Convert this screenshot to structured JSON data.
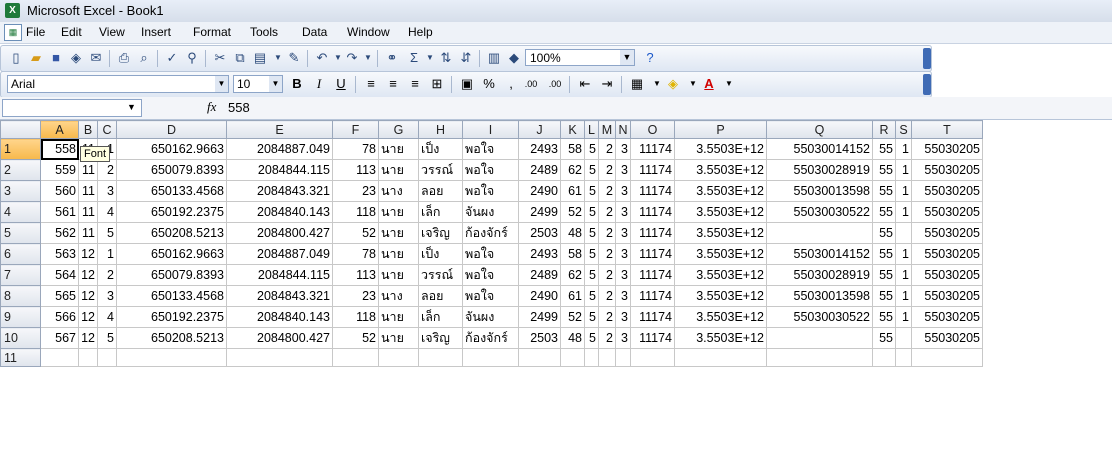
{
  "window": {
    "title": "Microsoft Excel - Book1",
    "app_icon_text": "X"
  },
  "menu": [
    "File",
    "Edit",
    "View",
    "Insert",
    "Format",
    "Tools",
    "Data",
    "Window",
    "Help"
  ],
  "toolbar": {
    "zoom": "100%"
  },
  "format_bar": {
    "font": "Arial",
    "size": "10",
    "bold": "B",
    "italic": "I",
    "underline": "U",
    "percent": "%",
    "comma": ",",
    "dec_inc": ".00",
    "dec_dec": ".00"
  },
  "formula_bar": {
    "fx": "fx",
    "value": "558"
  },
  "tooltip": "Font",
  "columns": [
    "A",
    "B",
    "C",
    "D",
    "E",
    "F",
    "G",
    "H",
    "I",
    "J",
    "K",
    "L",
    "M",
    "N",
    "O",
    "P",
    "Q",
    "R",
    "S",
    "T"
  ],
  "rows": [
    [
      "558",
      "11",
      "1",
      "650162.9663",
      "2084887.049",
      "78",
      "นาย",
      "เป็ง",
      "พอใจ",
      "2493",
      "58",
      "5",
      "2",
      "3",
      "11174",
      "3.5503E+12",
      "55030014152",
      "55",
      "1",
      "55030205"
    ],
    [
      "559",
      "11",
      "2",
      "650079.8393",
      "2084844.115",
      "113",
      "นาย",
      "วรรณ์",
      "พอใจ",
      "2489",
      "62",
      "5",
      "2",
      "3",
      "11174",
      "3.5503E+12",
      "55030028919",
      "55",
      "1",
      "55030205"
    ],
    [
      "560",
      "11",
      "3",
      "650133.4568",
      "2084843.321",
      "23",
      "นาง",
      "ลอย",
      "พอใจ",
      "2490",
      "61",
      "5",
      "2",
      "3",
      "11174",
      "3.5503E+12",
      "55030013598",
      "55",
      "1",
      "55030205"
    ],
    [
      "561",
      "11",
      "4",
      "650192.2375",
      "2084840.143",
      "118",
      "นาย",
      "เล็ก",
      "จันผง",
      "2499",
      "52",
      "5",
      "2",
      "3",
      "11174",
      "3.5503E+12",
      "55030030522",
      "55",
      "1",
      "55030205"
    ],
    [
      "562",
      "11",
      "5",
      "650208.5213",
      "2084800.427",
      "52",
      "นาย",
      "เจริญ",
      "ก้องจักร์",
      "2503",
      "48",
      "5",
      "2",
      "3",
      "11174",
      "3.5503E+12",
      "",
      "55",
      "",
      "55030205"
    ],
    [
      "563",
      "12",
      "1",
      "650162.9663",
      "2084887.049",
      "78",
      "นาย",
      "เป็ง",
      "พอใจ",
      "2493",
      "58",
      "5",
      "2",
      "3",
      "11174",
      "3.5503E+12",
      "55030014152",
      "55",
      "1",
      "55030205"
    ],
    [
      "564",
      "12",
      "2",
      "650079.8393",
      "2084844.115",
      "113",
      "นาย",
      "วรรณ์",
      "พอใจ",
      "2489",
      "62",
      "5",
      "2",
      "3",
      "11174",
      "3.5503E+12",
      "55030028919",
      "55",
      "1",
      "55030205"
    ],
    [
      "565",
      "12",
      "3",
      "650133.4568",
      "2084843.321",
      "23",
      "นาง",
      "ลอย",
      "พอใจ",
      "2490",
      "61",
      "5",
      "2",
      "3",
      "11174",
      "3.5503E+12",
      "55030013598",
      "55",
      "1",
      "55030205"
    ],
    [
      "566",
      "12",
      "4",
      "650192.2375",
      "2084840.143",
      "118",
      "นาย",
      "เล็ก",
      "จันผง",
      "2499",
      "52",
      "5",
      "2",
      "3",
      "11174",
      "3.5503E+12",
      "55030030522",
      "55",
      "1",
      "55030205"
    ],
    [
      "567",
      "12",
      "5",
      "650208.5213",
      "2084800.427",
      "52",
      "นาย",
      "เจริญ",
      "ก้องจักร์",
      "2503",
      "48",
      "5",
      "2",
      "3",
      "11174",
      "3.5503E+12",
      "",
      "55",
      "",
      "55030205"
    ],
    [
      "",
      "",
      "",
      "",
      "",
      "",
      "",
      "",
      "",
      "",
      "",
      "",
      "",
      "",
      "",
      "",
      "",
      "",
      "",
      ""
    ]
  ]
}
